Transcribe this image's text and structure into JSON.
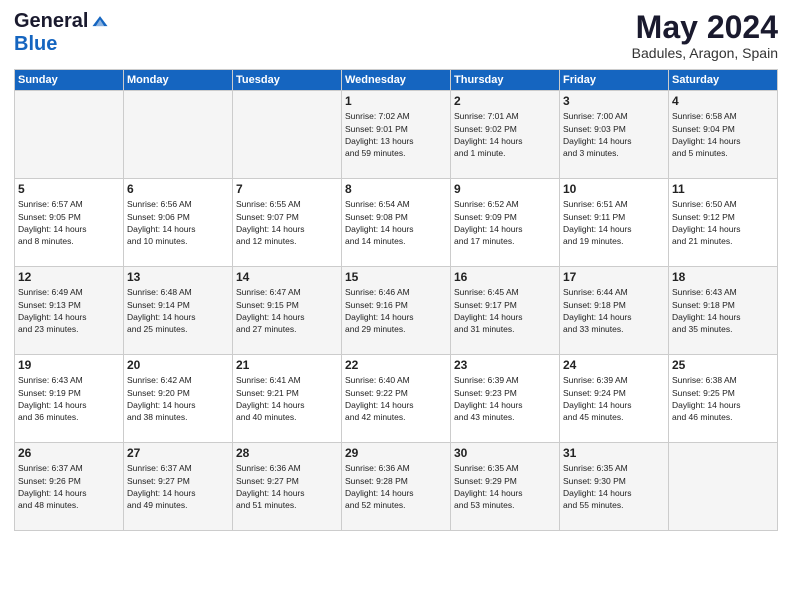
{
  "header": {
    "logo_general": "General",
    "logo_blue": "Blue",
    "month_title": "May 2024",
    "location": "Badules, Aragon, Spain"
  },
  "columns": [
    "Sunday",
    "Monday",
    "Tuesday",
    "Wednesday",
    "Thursday",
    "Friday",
    "Saturday"
  ],
  "weeks": [
    [
      {
        "day": "",
        "info": ""
      },
      {
        "day": "",
        "info": ""
      },
      {
        "day": "",
        "info": ""
      },
      {
        "day": "1",
        "info": "Sunrise: 7:02 AM\nSunset: 9:01 PM\nDaylight: 13 hours\nand 59 minutes."
      },
      {
        "day": "2",
        "info": "Sunrise: 7:01 AM\nSunset: 9:02 PM\nDaylight: 14 hours\nand 1 minute."
      },
      {
        "day": "3",
        "info": "Sunrise: 7:00 AM\nSunset: 9:03 PM\nDaylight: 14 hours\nand 3 minutes."
      },
      {
        "day": "4",
        "info": "Sunrise: 6:58 AM\nSunset: 9:04 PM\nDaylight: 14 hours\nand 5 minutes."
      }
    ],
    [
      {
        "day": "5",
        "info": "Sunrise: 6:57 AM\nSunset: 9:05 PM\nDaylight: 14 hours\nand 8 minutes."
      },
      {
        "day": "6",
        "info": "Sunrise: 6:56 AM\nSunset: 9:06 PM\nDaylight: 14 hours\nand 10 minutes."
      },
      {
        "day": "7",
        "info": "Sunrise: 6:55 AM\nSunset: 9:07 PM\nDaylight: 14 hours\nand 12 minutes."
      },
      {
        "day": "8",
        "info": "Sunrise: 6:54 AM\nSunset: 9:08 PM\nDaylight: 14 hours\nand 14 minutes."
      },
      {
        "day": "9",
        "info": "Sunrise: 6:52 AM\nSunset: 9:09 PM\nDaylight: 14 hours\nand 17 minutes."
      },
      {
        "day": "10",
        "info": "Sunrise: 6:51 AM\nSunset: 9:11 PM\nDaylight: 14 hours\nand 19 minutes."
      },
      {
        "day": "11",
        "info": "Sunrise: 6:50 AM\nSunset: 9:12 PM\nDaylight: 14 hours\nand 21 minutes."
      }
    ],
    [
      {
        "day": "12",
        "info": "Sunrise: 6:49 AM\nSunset: 9:13 PM\nDaylight: 14 hours\nand 23 minutes."
      },
      {
        "day": "13",
        "info": "Sunrise: 6:48 AM\nSunset: 9:14 PM\nDaylight: 14 hours\nand 25 minutes."
      },
      {
        "day": "14",
        "info": "Sunrise: 6:47 AM\nSunset: 9:15 PM\nDaylight: 14 hours\nand 27 minutes."
      },
      {
        "day": "15",
        "info": "Sunrise: 6:46 AM\nSunset: 9:16 PM\nDaylight: 14 hours\nand 29 minutes."
      },
      {
        "day": "16",
        "info": "Sunrise: 6:45 AM\nSunset: 9:17 PM\nDaylight: 14 hours\nand 31 minutes."
      },
      {
        "day": "17",
        "info": "Sunrise: 6:44 AM\nSunset: 9:18 PM\nDaylight: 14 hours\nand 33 minutes."
      },
      {
        "day": "18",
        "info": "Sunrise: 6:43 AM\nSunset: 9:18 PM\nDaylight: 14 hours\nand 35 minutes."
      }
    ],
    [
      {
        "day": "19",
        "info": "Sunrise: 6:43 AM\nSunset: 9:19 PM\nDaylight: 14 hours\nand 36 minutes."
      },
      {
        "day": "20",
        "info": "Sunrise: 6:42 AM\nSunset: 9:20 PM\nDaylight: 14 hours\nand 38 minutes."
      },
      {
        "day": "21",
        "info": "Sunrise: 6:41 AM\nSunset: 9:21 PM\nDaylight: 14 hours\nand 40 minutes."
      },
      {
        "day": "22",
        "info": "Sunrise: 6:40 AM\nSunset: 9:22 PM\nDaylight: 14 hours\nand 42 minutes."
      },
      {
        "day": "23",
        "info": "Sunrise: 6:39 AM\nSunset: 9:23 PM\nDaylight: 14 hours\nand 43 minutes."
      },
      {
        "day": "24",
        "info": "Sunrise: 6:39 AM\nSunset: 9:24 PM\nDaylight: 14 hours\nand 45 minutes."
      },
      {
        "day": "25",
        "info": "Sunrise: 6:38 AM\nSunset: 9:25 PM\nDaylight: 14 hours\nand 46 minutes."
      }
    ],
    [
      {
        "day": "26",
        "info": "Sunrise: 6:37 AM\nSunset: 9:26 PM\nDaylight: 14 hours\nand 48 minutes."
      },
      {
        "day": "27",
        "info": "Sunrise: 6:37 AM\nSunset: 9:27 PM\nDaylight: 14 hours\nand 49 minutes."
      },
      {
        "day": "28",
        "info": "Sunrise: 6:36 AM\nSunset: 9:27 PM\nDaylight: 14 hours\nand 51 minutes."
      },
      {
        "day": "29",
        "info": "Sunrise: 6:36 AM\nSunset: 9:28 PM\nDaylight: 14 hours\nand 52 minutes."
      },
      {
        "day": "30",
        "info": "Sunrise: 6:35 AM\nSunset: 9:29 PM\nDaylight: 14 hours\nand 53 minutes."
      },
      {
        "day": "31",
        "info": "Sunrise: 6:35 AM\nSunset: 9:30 PM\nDaylight: 14 hours\nand 55 minutes."
      },
      {
        "day": "",
        "info": ""
      }
    ]
  ]
}
